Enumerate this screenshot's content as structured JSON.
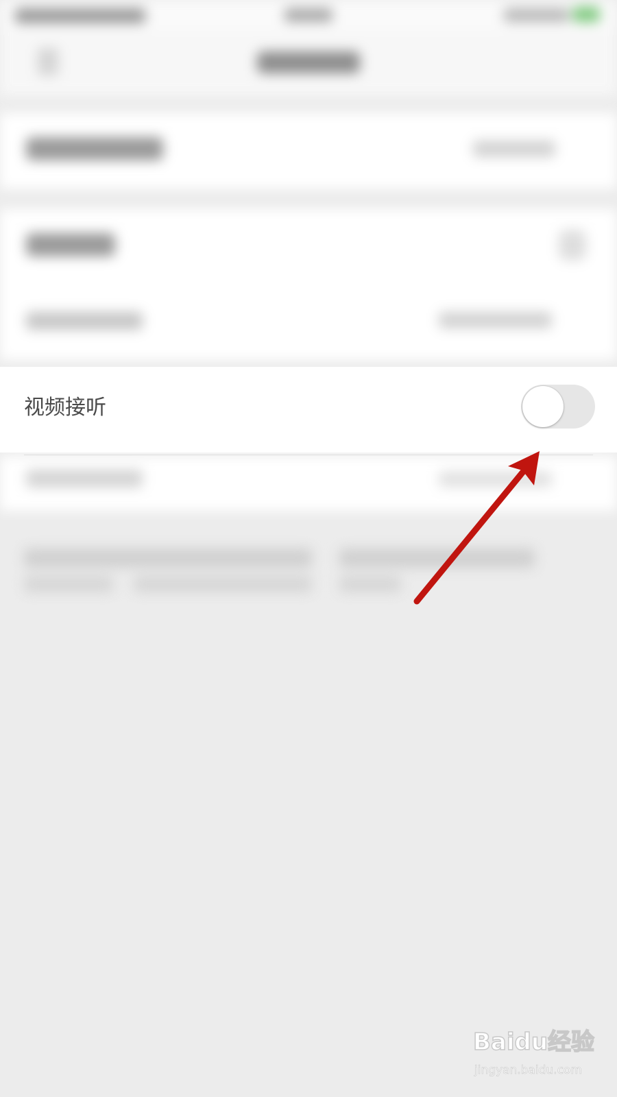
{
  "settings": {
    "video_answer_row": {
      "label": "视频接听",
      "toggle_on": false
    }
  },
  "watermark": {
    "brand": "Baidu经验",
    "url": "jingyan.baidu.com"
  },
  "colors": {
    "annotation_arrow": "#c0150f",
    "toggle_track_off": "#e6e6e6",
    "background": "#ececec"
  }
}
